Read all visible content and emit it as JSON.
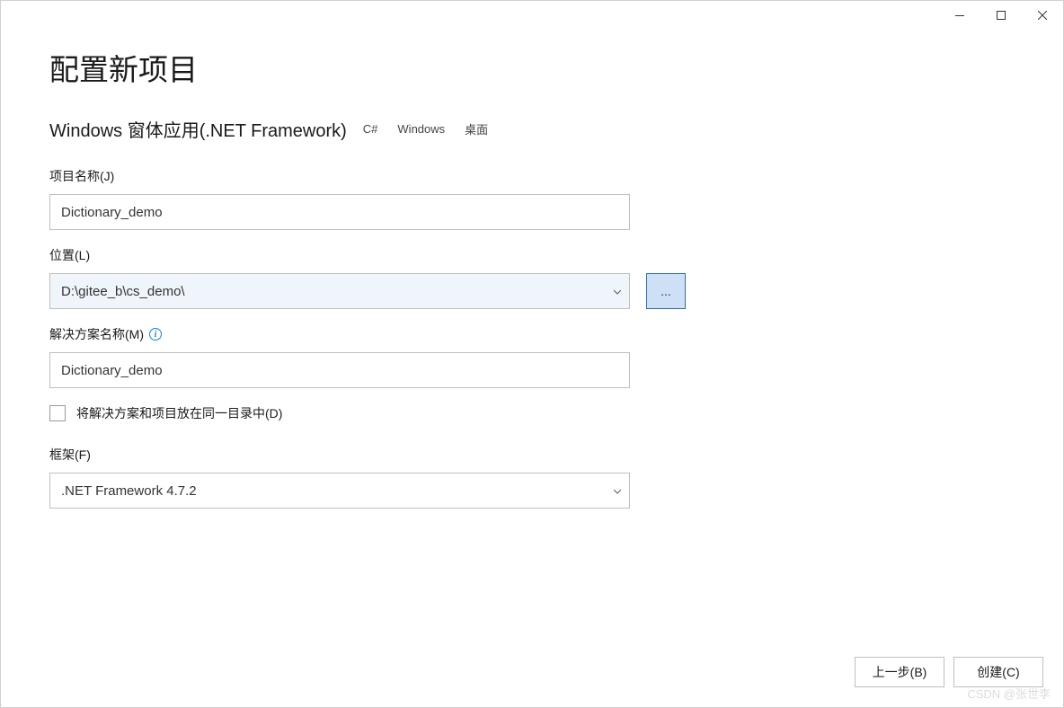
{
  "window": {
    "title": "配置新项目",
    "subtitle": "Windows 窗体应用(.NET Framework)",
    "tags": [
      "C#",
      "Windows",
      "桌面"
    ]
  },
  "fields": {
    "project_name": {
      "label": "项目名称(J)",
      "value": "Dictionary_demo"
    },
    "location": {
      "label": "位置(L)",
      "value": "D:\\gitee_b\\cs_demo\\",
      "browse_label": "..."
    },
    "solution_name": {
      "label": "解决方案名称(M)",
      "value": "Dictionary_demo"
    },
    "same_dir_checkbox": {
      "label": "将解决方案和项目放在同一目录中(D)",
      "checked": false
    },
    "framework": {
      "label": "框架(F)",
      "value": ".NET Framework 4.7.2"
    }
  },
  "footer": {
    "back_label": "上一步(B)",
    "create_label": "创建(C)"
  },
  "watermark": "CSDN @张世李"
}
